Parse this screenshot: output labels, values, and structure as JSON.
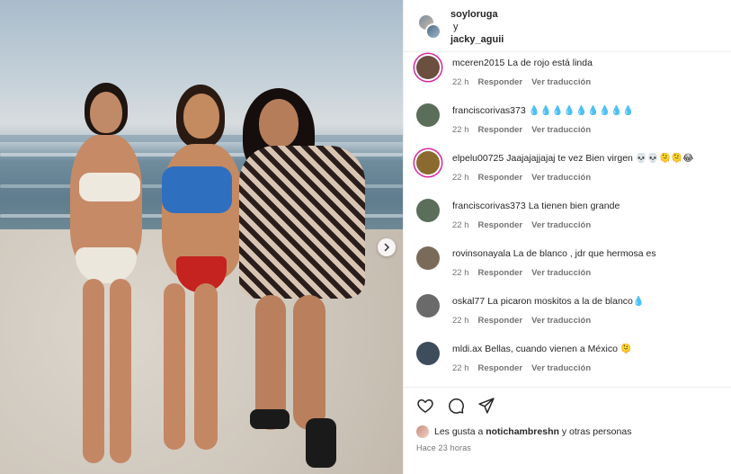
{
  "header": {
    "user1": "soyloruga",
    "conjunction": "y",
    "user2": "jacky_aguii"
  },
  "comments": [
    {
      "user": "mceren2015",
      "text": "La de rojo está linda",
      "time": "22 h",
      "reply": "Responder",
      "translate": "Ver traducción",
      "avatar": "#6b4f3f",
      "ring": true
    },
    {
      "user": "franciscorivas373",
      "text": "💧💧💧💧💧💧💧💧💧",
      "time": "22 h",
      "reply": "Responder",
      "translate": "Ver traducción",
      "avatar": "#5b6e5a",
      "ring": false
    },
    {
      "user": "elpelu00725",
      "text": "Jaajajajjajaj te vez Bien virgen 💀💀🫠🫠😂",
      "time": "22 h",
      "reply": "Responder",
      "translate": "Ver traducción",
      "avatar": "#8a6a2f",
      "ring": true
    },
    {
      "user": "franciscorivas373",
      "text": "La tienen bien grande",
      "time": "22 h",
      "reply": "Responder",
      "translate": "Ver traducción",
      "avatar": "#5b6e5a",
      "ring": false
    },
    {
      "user": "rovinsonayala",
      "text": "La de blanco , jdr que hermosa es",
      "time": "22 h",
      "reply": "Responder",
      "translate": "Ver traducción",
      "avatar": "#7a6a5a",
      "ring": false
    },
    {
      "user": "oskal77",
      "text": "La picaron moskitos a la de blanco💧",
      "time": "22 h",
      "reply": "Responder",
      "translate": "Ver traducción",
      "avatar": "#6a6a6a",
      "ring": false
    },
    {
      "user": "mldi.ax",
      "text": "Bellas, cuando vienen a México 🫠",
      "time": "22 h",
      "reply": "Responder",
      "translate": "Ver traducción",
      "avatar": "#3e4d5c",
      "ring": false
    }
  ],
  "likes": {
    "prefix": "Les gusta a",
    "user": "notichambreshn",
    "suffix": "y otras personas"
  },
  "timestamp": "Hace 23 horas",
  "icons": {
    "like": "heart-icon",
    "comment": "comment-icon",
    "share": "share-icon",
    "next": "chevron-right-icon"
  }
}
